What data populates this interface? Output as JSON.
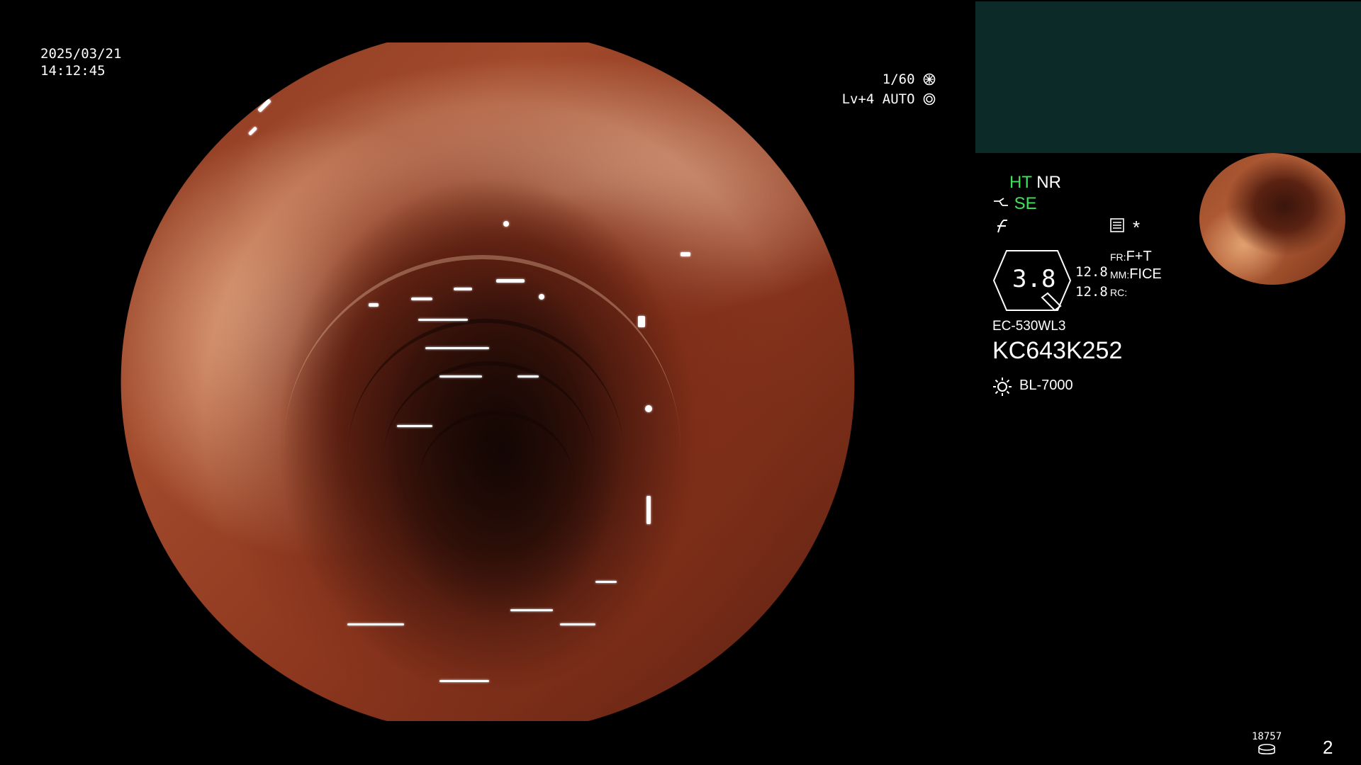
{
  "overlay": {
    "date": "2025/03/21",
    "time": "14:12:45",
    "shutter": "1/60",
    "iris": "Lv+4 AUTO"
  },
  "status": {
    "ht": "HT",
    "nr": "NR",
    "se": "SE"
  },
  "enhancement": {
    "dial_value": "3.8",
    "value_1": "12.8",
    "value_2": "12.8",
    "fr_label": "FR:",
    "fr_value": "F+T",
    "mm_label": "MM:",
    "mm_value": "FICE",
    "rc_label": "RC:"
  },
  "scope": {
    "model": "EC-530WL3",
    "serial": "KC643K252"
  },
  "light_source": "BL-7000",
  "footer": {
    "counter": "18757",
    "page": "2"
  },
  "icons": [
    "aperture-icon",
    "iris-auto-icon",
    "scope-tip-icon",
    "function-icon",
    "memo-icon",
    "asterisk-icon",
    "light-icon",
    "disk-icon"
  ],
  "colors": {
    "status_green": "#3de35a",
    "sub_panel": "#0c2a28",
    "background": "#000000"
  }
}
